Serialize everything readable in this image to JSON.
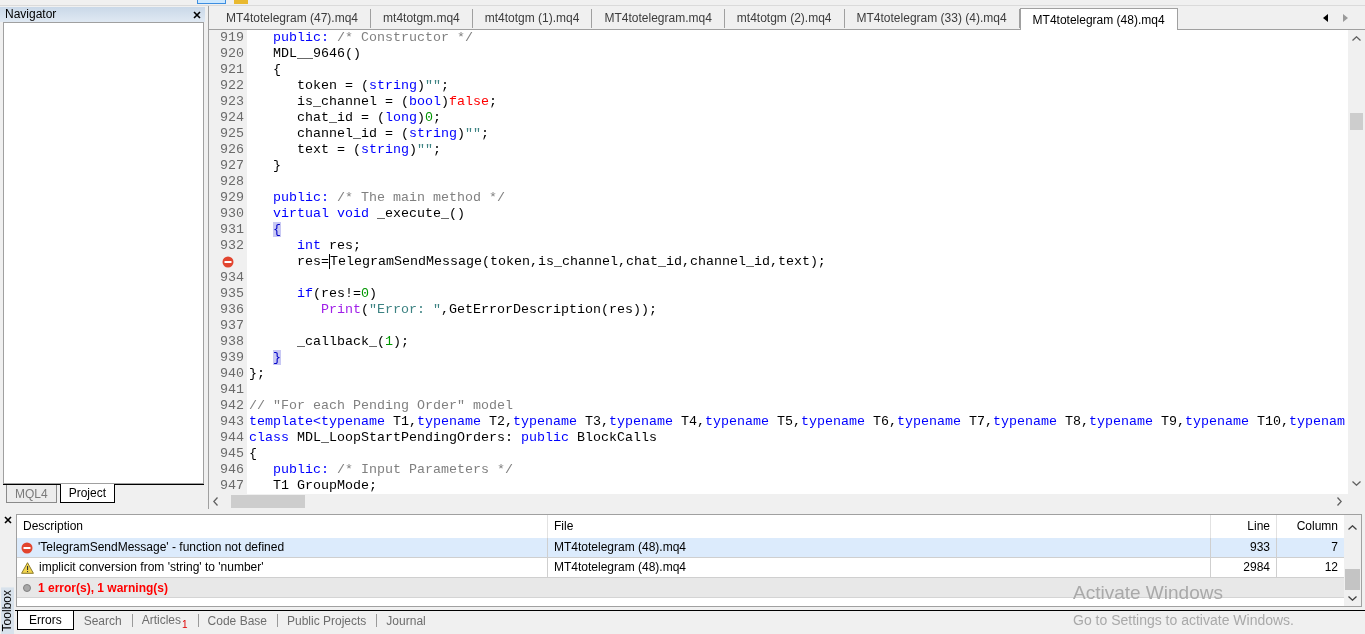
{
  "navigator": {
    "title": "Navigator",
    "tabs": [
      {
        "label": "MQL4",
        "selected": false
      },
      {
        "label": "Project",
        "selected": true
      }
    ]
  },
  "editor": {
    "tabs": [
      {
        "label": "MT4totelegram (47).mq4",
        "selected": false
      },
      {
        "label": "mt4totgm.mq4",
        "selected": false
      },
      {
        "label": "mt4totgm (1).mq4",
        "selected": false
      },
      {
        "label": "MT4totelegram.mq4",
        "selected": false
      },
      {
        "label": "mt4totgm (2).mq4",
        "selected": false
      },
      {
        "label": "MT4totelegram (33) (4).mq4",
        "selected": false
      },
      {
        "label": "MT4totelegram (48).mq4",
        "selected": true
      }
    ],
    "lines": [
      {
        "kind": "code",
        "number": "919",
        "tokens": [
          {
            "kind": "keyword",
            "text": "   public:"
          },
          {
            "kind": "comment",
            "text": " /* Constructor */"
          }
        ]
      },
      {
        "kind": "code",
        "number": "920",
        "tokens": [
          {
            "kind": "plain",
            "text": "   MDL__9646()"
          }
        ]
      },
      {
        "kind": "code",
        "number": "921",
        "tokens": [
          {
            "kind": "plain",
            "text": "   {"
          }
        ]
      },
      {
        "kind": "code",
        "number": "922",
        "tokens": [
          {
            "kind": "plain",
            "text": "      token = ("
          },
          {
            "kind": "keyword",
            "text": "string"
          },
          {
            "kind": "plain",
            "text": ")"
          },
          {
            "kind": "string",
            "text": "\"\""
          },
          {
            "kind": "plain",
            "text": ";"
          }
        ]
      },
      {
        "kind": "code",
        "number": "923",
        "tokens": [
          {
            "kind": "plain",
            "text": "      is_channel = ("
          },
          {
            "kind": "keyword",
            "text": "bool"
          },
          {
            "kind": "plain",
            "text": ")"
          },
          {
            "kind": "constant",
            "text": "false"
          },
          {
            "kind": "plain",
            "text": ";"
          }
        ]
      },
      {
        "kind": "code",
        "number": "924",
        "tokens": [
          {
            "kind": "plain",
            "text": "      chat_id = ("
          },
          {
            "kind": "keyword",
            "text": "long"
          },
          {
            "kind": "plain",
            "text": ")"
          },
          {
            "kind": "number",
            "text": "0"
          },
          {
            "kind": "plain",
            "text": ";"
          }
        ]
      },
      {
        "kind": "code",
        "number": "925",
        "tokens": [
          {
            "kind": "plain",
            "text": "      channel_id = ("
          },
          {
            "kind": "keyword",
            "text": "string"
          },
          {
            "kind": "plain",
            "text": ")"
          },
          {
            "kind": "string",
            "text": "\"\""
          },
          {
            "kind": "plain",
            "text": ";"
          }
        ]
      },
      {
        "kind": "code",
        "number": "926",
        "tokens": [
          {
            "kind": "plain",
            "text": "      text = ("
          },
          {
            "kind": "keyword",
            "text": "string"
          },
          {
            "kind": "plain",
            "text": ")"
          },
          {
            "kind": "string",
            "text": "\"\""
          },
          {
            "kind": "plain",
            "text": ";"
          }
        ]
      },
      {
        "kind": "code",
        "number": "927",
        "tokens": [
          {
            "kind": "plain",
            "text": "   }"
          }
        ]
      },
      {
        "kind": "code",
        "number": "928"
      },
      {
        "kind": "code",
        "number": "929",
        "tokens": [
          {
            "kind": "keyword",
            "text": "   public:"
          },
          {
            "kind": "comment",
            "text": " /* The main method */"
          }
        ]
      },
      {
        "kind": "code",
        "number": "930",
        "tokens": [
          {
            "kind": "keyword",
            "text": "   virtual void"
          },
          {
            "kind": "plain",
            "text": " _execute_()"
          }
        ]
      },
      {
        "kind": "code",
        "number": "931",
        "tokens": [
          {
            "kind": "bracket-match",
            "text": "   {"
          }
        ]
      },
      {
        "kind": "code",
        "number": "932",
        "tokens": [
          {
            "kind": "keyword",
            "text": "      int"
          },
          {
            "kind": "plain",
            "text": " res;"
          }
        ]
      },
      {
        "kind": "error",
        "tokens": [
          {
            "kind": "plain",
            "text": "      res="
          },
          {
            "kind": "caret",
            "text": "TelegramSendMessage(token,is_channel,chat_id,channel_id,text);"
          }
        ]
      },
      {
        "kind": "code",
        "number": "934"
      },
      {
        "kind": "code",
        "number": "935",
        "tokens": [
          {
            "kind": "keyword",
            "text": "      if"
          },
          {
            "kind": "plain",
            "text": "(res!="
          },
          {
            "kind": "number",
            "text": "0"
          },
          {
            "kind": "plain",
            "text": ")"
          }
        ]
      },
      {
        "kind": "code",
        "number": "936",
        "tokens": [
          {
            "kind": "builtin",
            "text": "         Print"
          },
          {
            "kind": "plain",
            "text": "("
          },
          {
            "kind": "string",
            "text": "\"Error: \""
          },
          {
            "kind": "plain",
            "text": ",GetErrorDescription(res));"
          }
        ]
      },
      {
        "kind": "code",
        "number": "937"
      },
      {
        "kind": "code",
        "number": "938",
        "tokens": [
          {
            "kind": "plain",
            "text": "      _callback_("
          },
          {
            "kind": "number",
            "text": "1"
          },
          {
            "kind": "plain",
            "text": ");"
          }
        ]
      },
      {
        "kind": "code",
        "number": "939",
        "tokens": [
          {
            "kind": "bracket-match",
            "text": "   }"
          }
        ]
      },
      {
        "kind": "code",
        "number": "940",
        "tokens": [
          {
            "kind": "plain",
            "text": "};"
          }
        ]
      },
      {
        "kind": "code",
        "number": "941"
      },
      {
        "kind": "code",
        "number": "942",
        "tokens": [
          {
            "kind": "comment",
            "text": "// \"For each Pending Order\" model"
          }
        ]
      },
      {
        "kind": "code",
        "number": "943",
        "tokens": [
          {
            "kind": "keyword",
            "text": "template<typename"
          },
          {
            "kind": "plain",
            "text": " T1,"
          },
          {
            "kind": "keyword",
            "text": "typename"
          },
          {
            "kind": "plain",
            "text": " T2,"
          },
          {
            "kind": "keyword",
            "text": "typename"
          },
          {
            "kind": "plain",
            "text": " T3,"
          },
          {
            "kind": "keyword",
            "text": "typename"
          },
          {
            "kind": "plain",
            "text": " T4,"
          },
          {
            "kind": "keyword",
            "text": "typename"
          },
          {
            "kind": "plain",
            "text": " T5,"
          },
          {
            "kind": "keyword",
            "text": "typename"
          },
          {
            "kind": "plain",
            "text": " T6,"
          },
          {
            "kind": "keyword",
            "text": "typename"
          },
          {
            "kind": "plain",
            "text": " T7,"
          },
          {
            "kind": "keyword",
            "text": "typename"
          },
          {
            "kind": "plain",
            "text": " T8,"
          },
          {
            "kind": "keyword",
            "text": "typename"
          },
          {
            "kind": "plain",
            "text": " T9,"
          },
          {
            "kind": "keyword",
            "text": "typename"
          },
          {
            "kind": "plain",
            "text": " T10,"
          },
          {
            "kind": "keyword",
            "text": "typenam"
          }
        ]
      },
      {
        "kind": "code",
        "number": "944",
        "tokens": [
          {
            "kind": "keyword",
            "text": "class"
          },
          {
            "kind": "plain",
            "text": " MDL_LoopStartPendingOrders: "
          },
          {
            "kind": "keyword",
            "text": "public"
          },
          {
            "kind": "plain",
            "text": " BlockCalls"
          }
        ]
      },
      {
        "kind": "code",
        "number": "945",
        "tokens": [
          {
            "kind": "plain",
            "text": "{"
          }
        ]
      },
      {
        "kind": "code",
        "number": "946",
        "tokens": [
          {
            "kind": "keyword",
            "text": "   public:"
          },
          {
            "kind": "comment",
            "text": " /* Input Parameters */"
          }
        ]
      },
      {
        "kind": "code",
        "number": "947",
        "tokens": [
          {
            "kind": "plain",
            "text": "   T1 GroupMode;"
          }
        ]
      }
    ]
  },
  "toolbox": {
    "title": "Toolbox",
    "columns": [
      "Description",
      "File",
      "Line",
      "Column"
    ],
    "rows": [
      {
        "kind": "error",
        "selected": true,
        "description": "'TelegramSendMessage' - function not defined",
        "file": "MT4totelegram (48).mq4",
        "line": "933",
        "column": "7"
      },
      {
        "kind": "warning",
        "selected": false,
        "description": "implicit conversion from 'string' to 'number'",
        "file": "MT4totelegram (48).mq4",
        "line": "2984",
        "column": "12"
      }
    ],
    "summary": "1 error(s), 1 warning(s)",
    "tabs": [
      {
        "label": "Errors",
        "selected": true
      },
      {
        "label": "Search",
        "selected": false
      },
      {
        "label": "Articles",
        "badge": "1",
        "selected": false
      },
      {
        "label": "Code Base",
        "selected": false
      },
      {
        "label": "Public Projects",
        "selected": false
      },
      {
        "label": "Journal",
        "selected": false
      }
    ]
  },
  "os_notice": {
    "title": "Activate Windows",
    "text": "Go to Settings to activate Windows."
  }
}
